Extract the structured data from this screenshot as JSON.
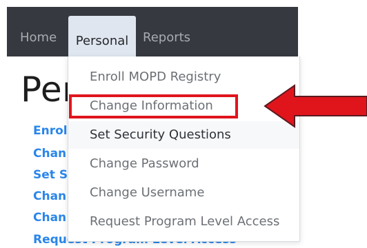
{
  "nav": {
    "home": "Home",
    "personal": "Personal",
    "reports": "Reports"
  },
  "page": {
    "title_fragment": "Per",
    "links": [
      "Enrol",
      "Chan",
      "Set Se",
      "Chan",
      "Chan",
      "Request Program Level Access"
    ]
  },
  "dropdown": {
    "items": [
      "Enroll MOPD Registry",
      "Change Information",
      "Set Security Questions",
      "Change Password",
      "Change Username",
      "Request Program Level Access"
    ]
  },
  "annotation": {
    "highlight_color": "#e0151c",
    "arrow_color": "#e0151c",
    "highlighted_item": "Change Information"
  }
}
